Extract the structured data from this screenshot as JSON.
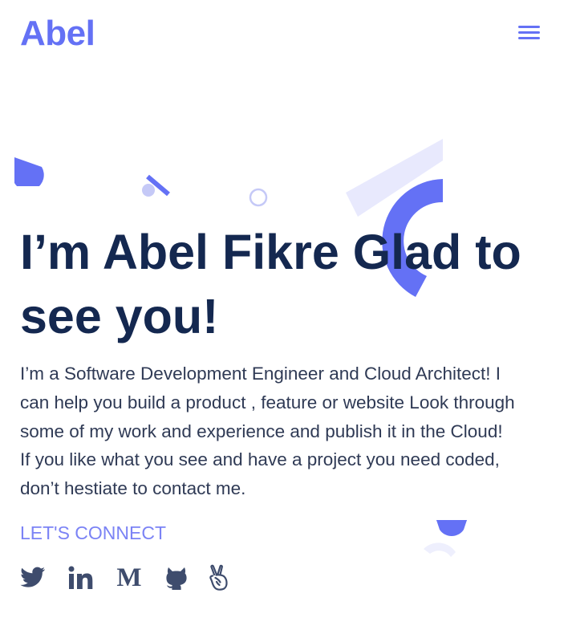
{
  "header": {
    "logo": "Abel",
    "menu_icon": "hamburger-menu-icon"
  },
  "hero": {
    "title_lines": [
      "I’m Abel Fikre Glad to",
      "see you!"
    ],
    "description_lines": [
      "I’m a Software Development Engineer and Cloud Architect! I",
      "can help you build a product , feature or website Look through",
      "some of my work and experience and publish it in the Cloud!",
      "If you like what you see and have a project you need coded,",
      "don’t hestiate to contact me."
    ],
    "connect_label": "LET'S CONNECT"
  },
  "social_links": [
    {
      "icon": "twitter-icon"
    },
    {
      "icon": "linkedin-icon"
    },
    {
      "icon": "medium-icon",
      "glyph": "M"
    },
    {
      "icon": "github-icon"
    },
    {
      "icon": "angellist-icon"
    }
  ],
  "colors": {
    "accent": "#6471f5",
    "accent_light": "#7b83f5",
    "pale_accent": "#e8e9fd",
    "heading": "#142850",
    "body_text": "#2f3a55",
    "social_icon": "#3e4c6d"
  }
}
